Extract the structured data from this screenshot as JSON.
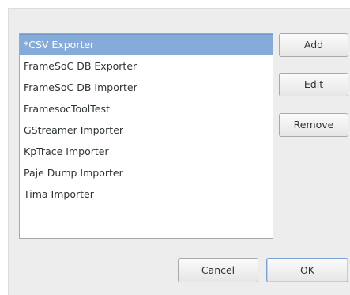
{
  "list": {
    "items": [
      {
        "label": "*CSV Exporter",
        "selected": true
      },
      {
        "label": "FrameSoC DB Exporter",
        "selected": false
      },
      {
        "label": "FrameSoC DB Importer",
        "selected": false
      },
      {
        "label": "FramesocToolTest",
        "selected": false
      },
      {
        "label": "GStreamer Importer",
        "selected": false
      },
      {
        "label": "KpTrace Importer",
        "selected": false
      },
      {
        "label": "Paje Dump Importer",
        "selected": false
      },
      {
        "label": "Tima Importer",
        "selected": false
      }
    ]
  },
  "buttons": {
    "add": "Add",
    "edit": "Edit",
    "remove": "Remove",
    "cancel": "Cancel",
    "ok": "OK"
  },
  "colors": {
    "selection": "#86abd9",
    "dialog_background": "#ededed",
    "default_button_border": "#7ba0d1"
  }
}
